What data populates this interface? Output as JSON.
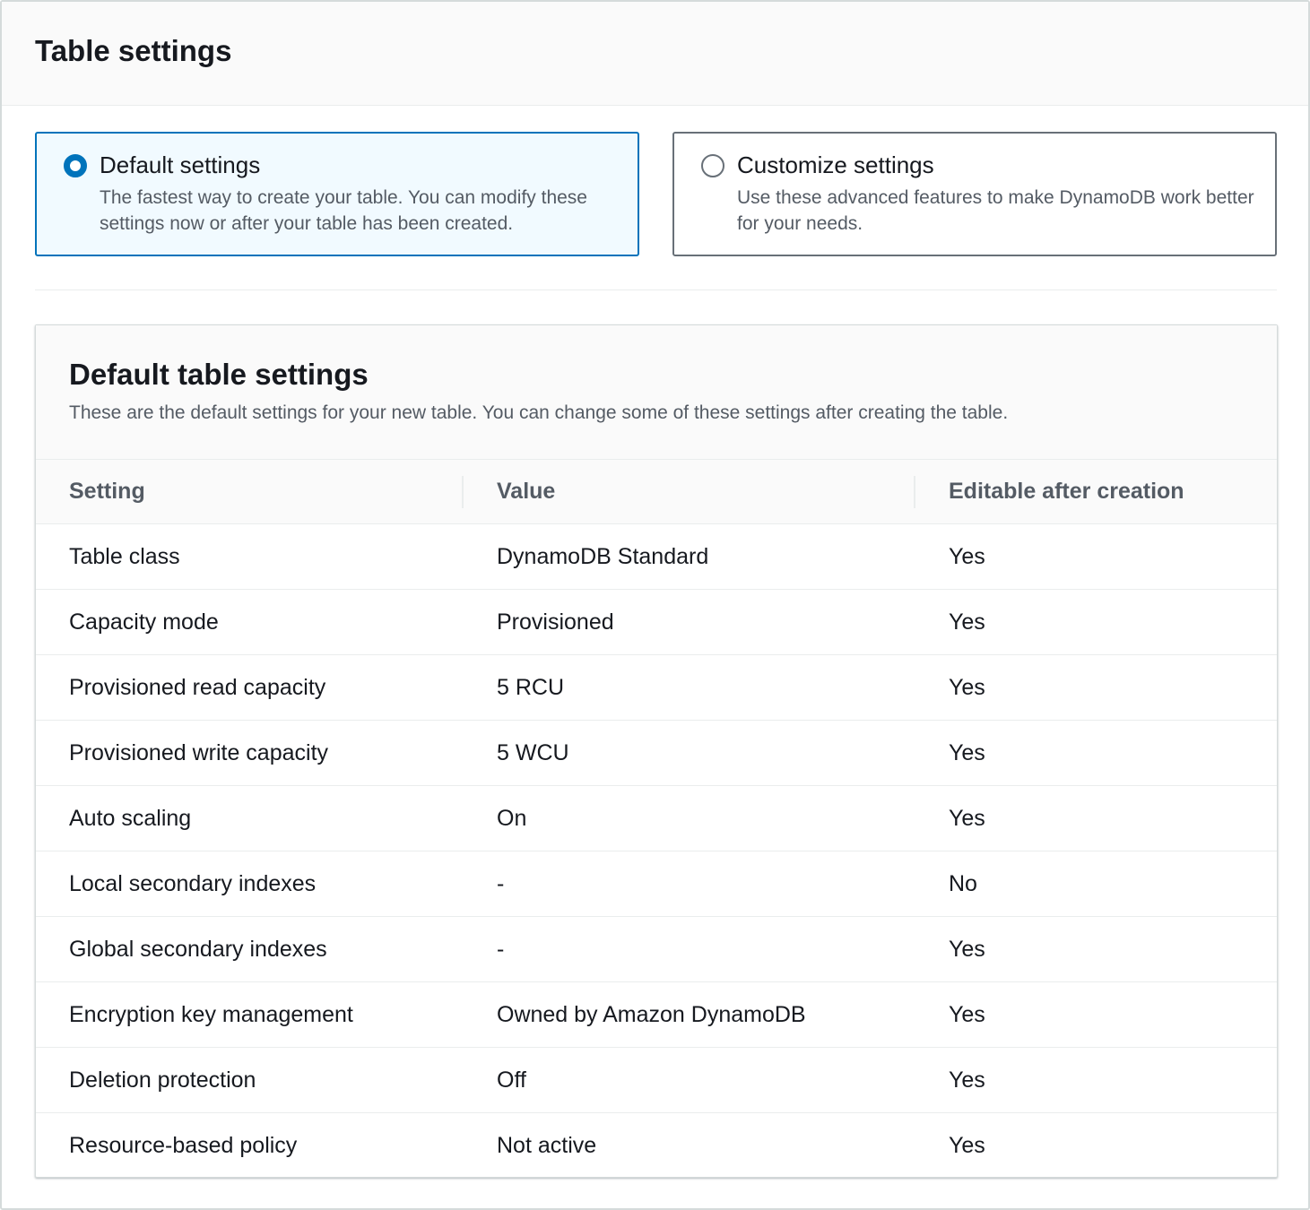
{
  "container": {
    "title": "Table settings"
  },
  "tiles": [
    {
      "label": "Default settings",
      "description": "The fastest way to create your table. You can modify these settings now or after your table has been created.",
      "selected": true
    },
    {
      "label": "Customize settings",
      "description": "Use these advanced features to make DynamoDB work better for your needs.",
      "selected": false
    }
  ],
  "panel": {
    "title": "Default table settings",
    "description": "These are the default settings for your new table. You can change some of these settings after creating the table."
  },
  "table": {
    "headers": [
      "Setting",
      "Value",
      "Editable after creation"
    ],
    "rows": [
      [
        "Table class",
        "DynamoDB Standard",
        "Yes"
      ],
      [
        "Capacity mode",
        "Provisioned",
        "Yes"
      ],
      [
        "Provisioned read capacity",
        "5 RCU",
        "Yes"
      ],
      [
        "Provisioned write capacity",
        "5 WCU",
        "Yes"
      ],
      [
        "Auto scaling",
        "On",
        "Yes"
      ],
      [
        "Local secondary indexes",
        "-",
        "No"
      ],
      [
        "Global secondary indexes",
        "-",
        "Yes"
      ],
      [
        "Encryption key management",
        "Owned by Amazon DynamoDB",
        "Yes"
      ],
      [
        "Deletion protection",
        "Off",
        "Yes"
      ],
      [
        "Resource-based policy",
        "Not active",
        "Yes"
      ]
    ]
  },
  "colors": {
    "accent": "#0073bb",
    "selected_tile_bg": "#f1faff",
    "text_primary": "#16191f",
    "text_secondary": "#545b64"
  }
}
